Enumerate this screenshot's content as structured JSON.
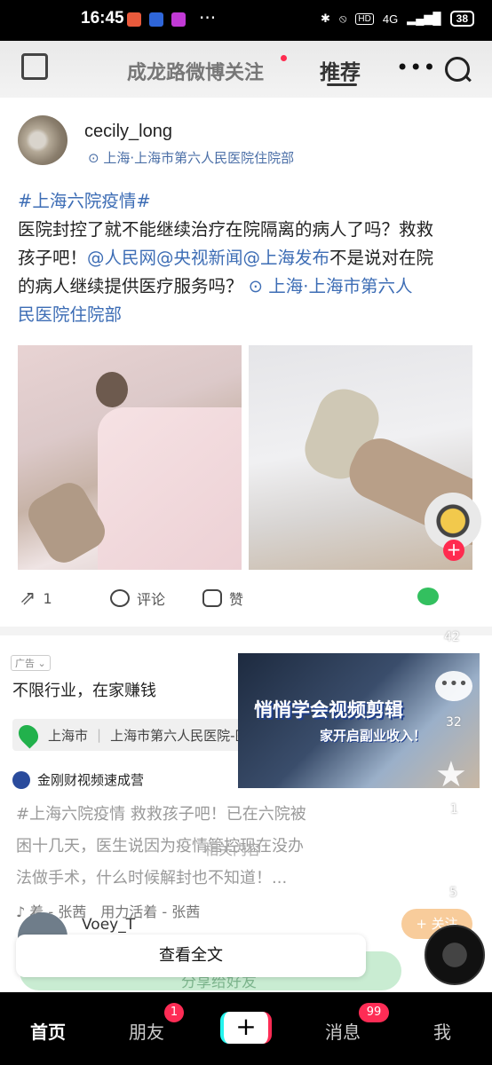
{
  "status": {
    "time": "16:45",
    "network": "4G",
    "battery": "38"
  },
  "topnav": {
    "title": "成龙路微博关注",
    "recommend": "推荐",
    "more": "•••"
  },
  "post": {
    "username": "cecily_long",
    "location": "上海·上海市第六人民医院住院部",
    "hashtag": "#上海六院疫情#",
    "text_line1": "医院封控了就不能继续治疗在院隔离的病人了吗？救救",
    "text_line2_a": "孩子吧！",
    "mention": "@人民网@央视新闻@上海发布",
    "text_line2_b": "不是说对在院",
    "text_line3": "的病人继续提供医疗服务吗？",
    "inline_location": "上海·上海市第六人",
    "inline_location_2": "民医院住院部",
    "actions": {
      "repost_count": "1",
      "comment_label": "评论",
      "like_label": "赞"
    }
  },
  "ad": {
    "tag": "广告",
    "title": "不限行业，在家赚钱",
    "loc_city": "上海市",
    "loc_place": "上海市第六人民医院-医技楼",
    "image_line1": "悄悄学会视频剪辑",
    "image_line2": "家开启副业收入！",
    "author": "金刚财视频速成营"
  },
  "video": {
    "caption_line1": "#上海六院疫情 救救孩子吧！已在六院被",
    "caption_line2": "困十几天，医生说因为疫情管控现在没办",
    "caption_line3": "法做手术，什么时候解封也不知道！...",
    "related": "相关内容",
    "music": "着 - 张茜　用力活着 - 张茜",
    "username": "Voey_T",
    "read_all": "查看全文",
    "share_friends": "分享给好友",
    "like_count": "42",
    "comment_count": "32",
    "fav_count": "1",
    "share_count": "5",
    "follow": "+ 关注"
  },
  "bottomnav": {
    "home": "首页",
    "friends": "朋友",
    "friends_badge": "1",
    "inbox": "消息",
    "inbox_badge": "99",
    "me": "我"
  }
}
